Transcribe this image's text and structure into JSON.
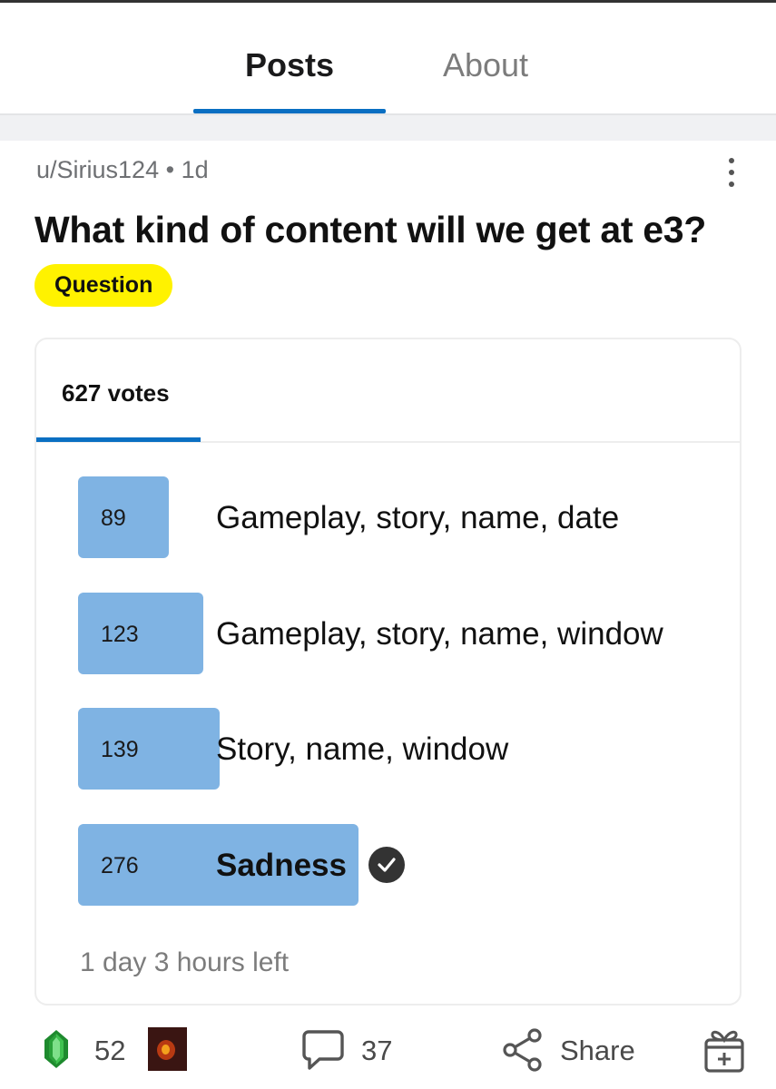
{
  "tabs": {
    "posts": "Posts",
    "about": "About",
    "active": "posts"
  },
  "post": {
    "author": "u/Sirius124",
    "separator": "•",
    "age": "1d",
    "title": "What kind of content will we get at e3?",
    "flair": "Question",
    "flair_color": "#fff200"
  },
  "poll": {
    "votes_label": "627 votes",
    "bar_color": "#7fb3e3",
    "options": [
      {
        "count": "89",
        "label": "Gameplay, story, name, date",
        "share": 0.142
      },
      {
        "count": "123",
        "label": "Gameplay, story, name, window",
        "share": 0.196
      },
      {
        "count": "139",
        "label": "Story, name, window",
        "share": 0.222
      },
      {
        "count": "276",
        "label": "Sadness",
        "share": 0.44,
        "winner": true
      }
    ],
    "time_left": "1 day 3 hours left"
  },
  "actions": {
    "upvotes": "52",
    "comments": "37",
    "share": "Share"
  },
  "icons": {
    "more": "more-vertical-icon",
    "check": "check-circle-icon",
    "upvote": "green-gem-icon",
    "comment": "comment-bubble-icon",
    "share": "share-icon",
    "gift": "gift-award-icon"
  },
  "colors": {
    "accent": "#0a6fc2"
  }
}
